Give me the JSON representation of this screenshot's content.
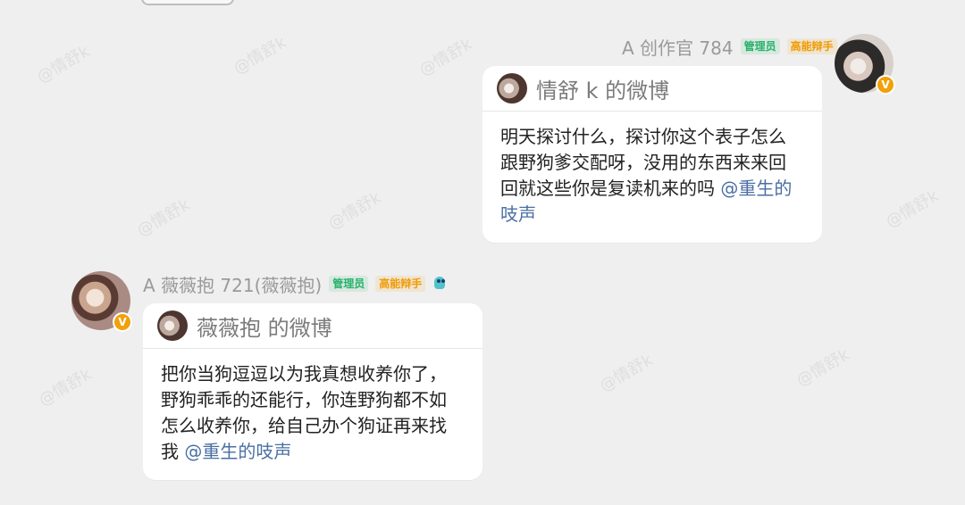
{
  "watermark_text": "@情舒k",
  "messages": [
    {
      "sender": "A 创作官 784",
      "badges": {
        "admin": "管理员",
        "skill": "高能辩手"
      },
      "card": {
        "title": "情舒 k 的微博",
        "body": "明天探讨什么，探讨你这个表子怎么\n跟野狗爹交配呀，没用的东西来来回\n回就这些你是复读机来的吗 ",
        "mention_line1": "@重生的",
        "mention_line2": "吱声"
      }
    },
    {
      "sender": "A 薇薇抱 721(薇薇抱)",
      "badges": {
        "admin": "管理员",
        "skill": "高能辩手"
      },
      "card": {
        "title": "薇薇抱 的微博",
        "body": "把你当狗逗逗以为我真想收养你了，\n野狗乖乖的还能行，你连野狗都不如\n怎么收养你，给自己办个狗证再来找\n我 ",
        "mention": "@重生的吱声"
      }
    }
  ]
}
